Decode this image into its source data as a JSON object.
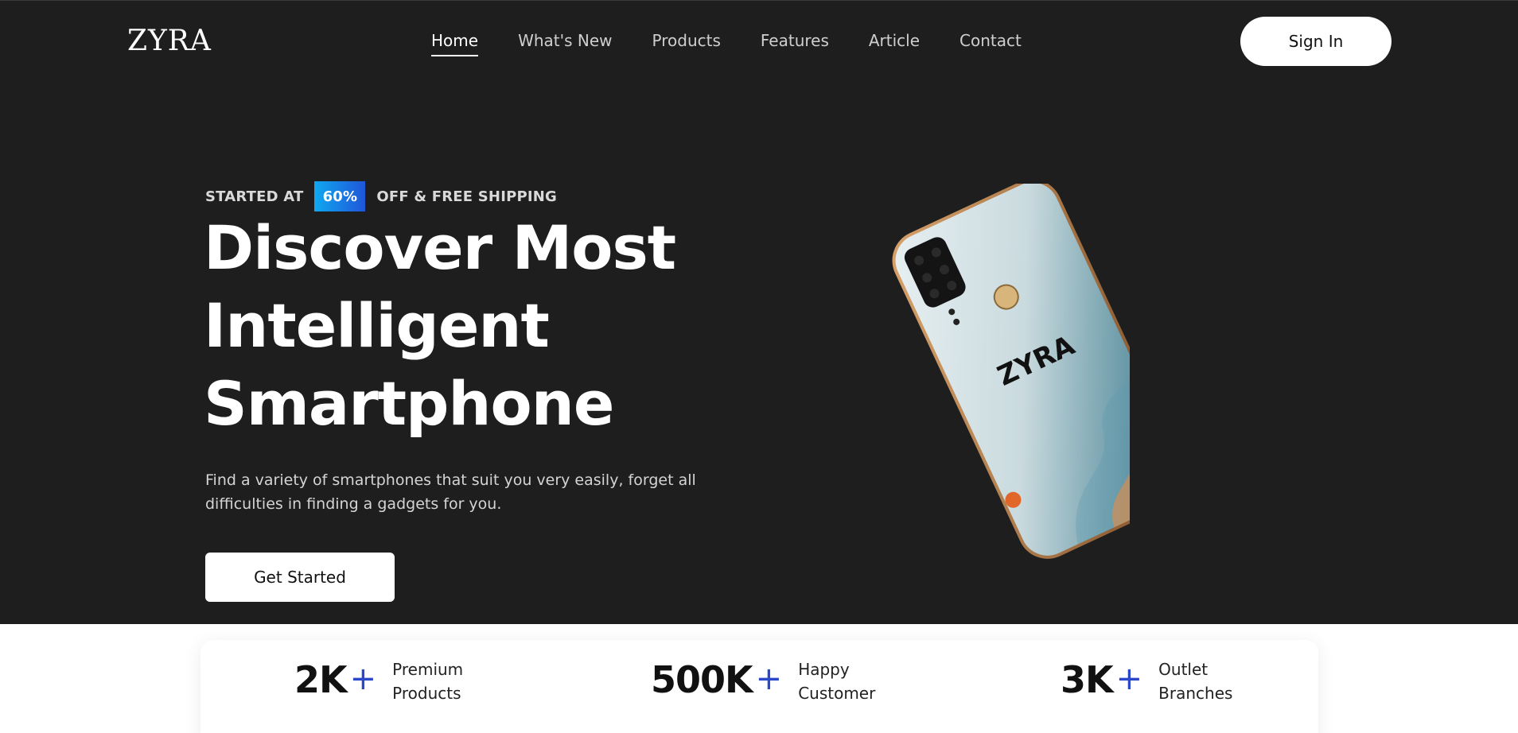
{
  "brand": {
    "logo": "ZYRA"
  },
  "nav": {
    "items": [
      {
        "label": "Home",
        "active": true
      },
      {
        "label": "What's New",
        "active": false
      },
      {
        "label": "Products",
        "active": false
      },
      {
        "label": "Features",
        "active": false
      },
      {
        "label": "Article",
        "active": false
      },
      {
        "label": "Contact",
        "active": false
      }
    ],
    "signin_label": "Sign In"
  },
  "hero": {
    "promo_prefix": "STARTED AT",
    "promo_badge": "60%",
    "promo_suffix": "OFF & FREE SHIPPING",
    "headline_lines": [
      "Discover Most",
      "Intelligent",
      "Smartphone"
    ],
    "description": "Find a variety of smartphones that suit you very easily, forget all difficulties in finding a gadgets for you.",
    "cta_label": "Get Started",
    "phone_brand": "ZYRA"
  },
  "stats": [
    {
      "value": "2K",
      "plus": "+",
      "label_line1": "Premium",
      "label_line2": "Products"
    },
    {
      "value": "500K",
      "plus": "+",
      "label_line1": "Happy",
      "label_line2": "Customer"
    },
    {
      "value": "3K",
      "plus": "+",
      "label_line1": "Outlet",
      "label_line2": "Branches"
    }
  ],
  "colors": {
    "hero_bg": "#1e1e1e",
    "accent_blue": "#2a48c9",
    "badge_gradient_start": "#10a8f0",
    "badge_gradient_end": "#1f56d8"
  }
}
